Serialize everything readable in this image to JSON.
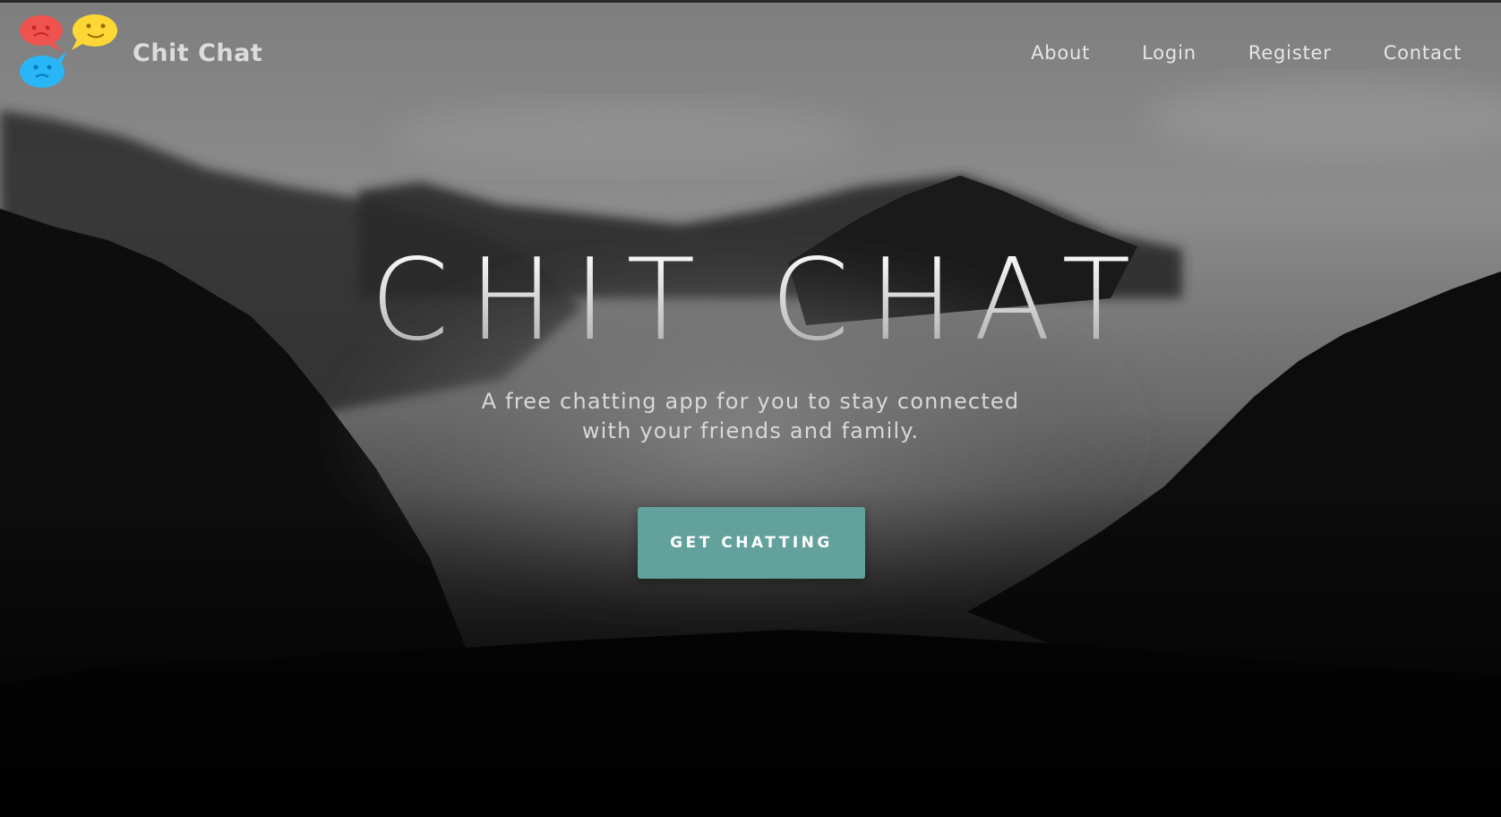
{
  "header": {
    "brand": "Chit Chat",
    "logo_icon": "chat-bubbles-logo",
    "nav": [
      {
        "label": "About"
      },
      {
        "label": "Login"
      },
      {
        "label": "Register"
      },
      {
        "label": "Contact"
      }
    ]
  },
  "hero": {
    "title": "CHIT CHAT",
    "subtitle_line1": "A free chatting app for you to stay connected",
    "subtitle_line2": "with your friends and family.",
    "cta_label": "GET CHATTING",
    "background": "foggy-mountain-forest-grayscale"
  },
  "colors": {
    "accent": "#62a19c",
    "logo_red": "#ef5350",
    "logo_yellow": "#fdd835",
    "logo_blue": "#29b6f6"
  }
}
